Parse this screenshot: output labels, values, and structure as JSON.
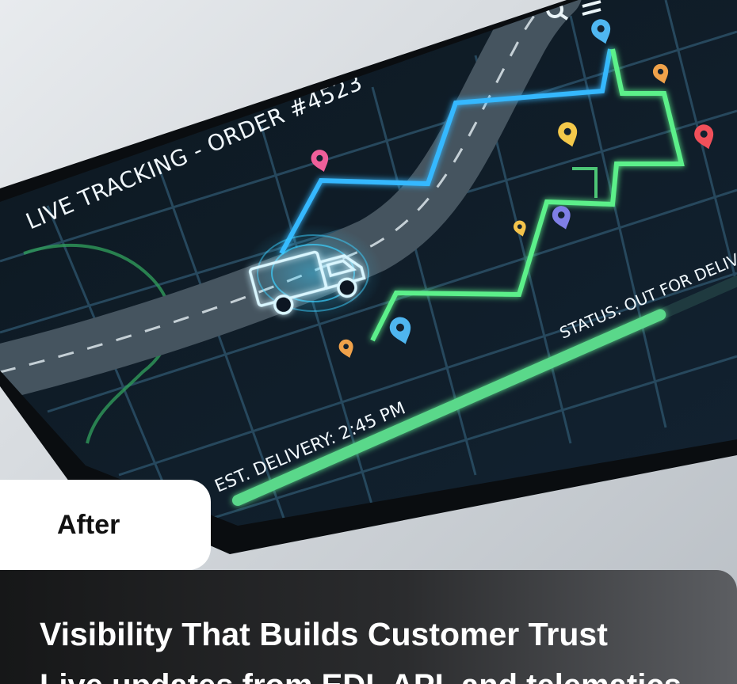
{
  "screen": {
    "title": "LIVE TRACKING - ORDER #4523",
    "status": "STATUS: OUT FOR DELIVE",
    "eta": "EST. DELIVERY: 2:45 PM",
    "progress": 0.92
  },
  "icons": [
    "search-icon",
    "menu-icon",
    "truck-icon",
    "map-pin-icon"
  ],
  "pin_colors": [
    "#4fb6f0",
    "#f0a24a",
    "#f0505a",
    "#f5c94a",
    "#ef5f9a",
    "#7f7fe6",
    "#f3c34b"
  ],
  "route_colors": {
    "blue": "#36b8ff",
    "green": "#5cf08a"
  },
  "badge": {
    "label": "After"
  },
  "caption": {
    "title": "Visibility That Builds Customer Trust",
    "subtitle": "Live updates from EDI, API, and telematics"
  }
}
